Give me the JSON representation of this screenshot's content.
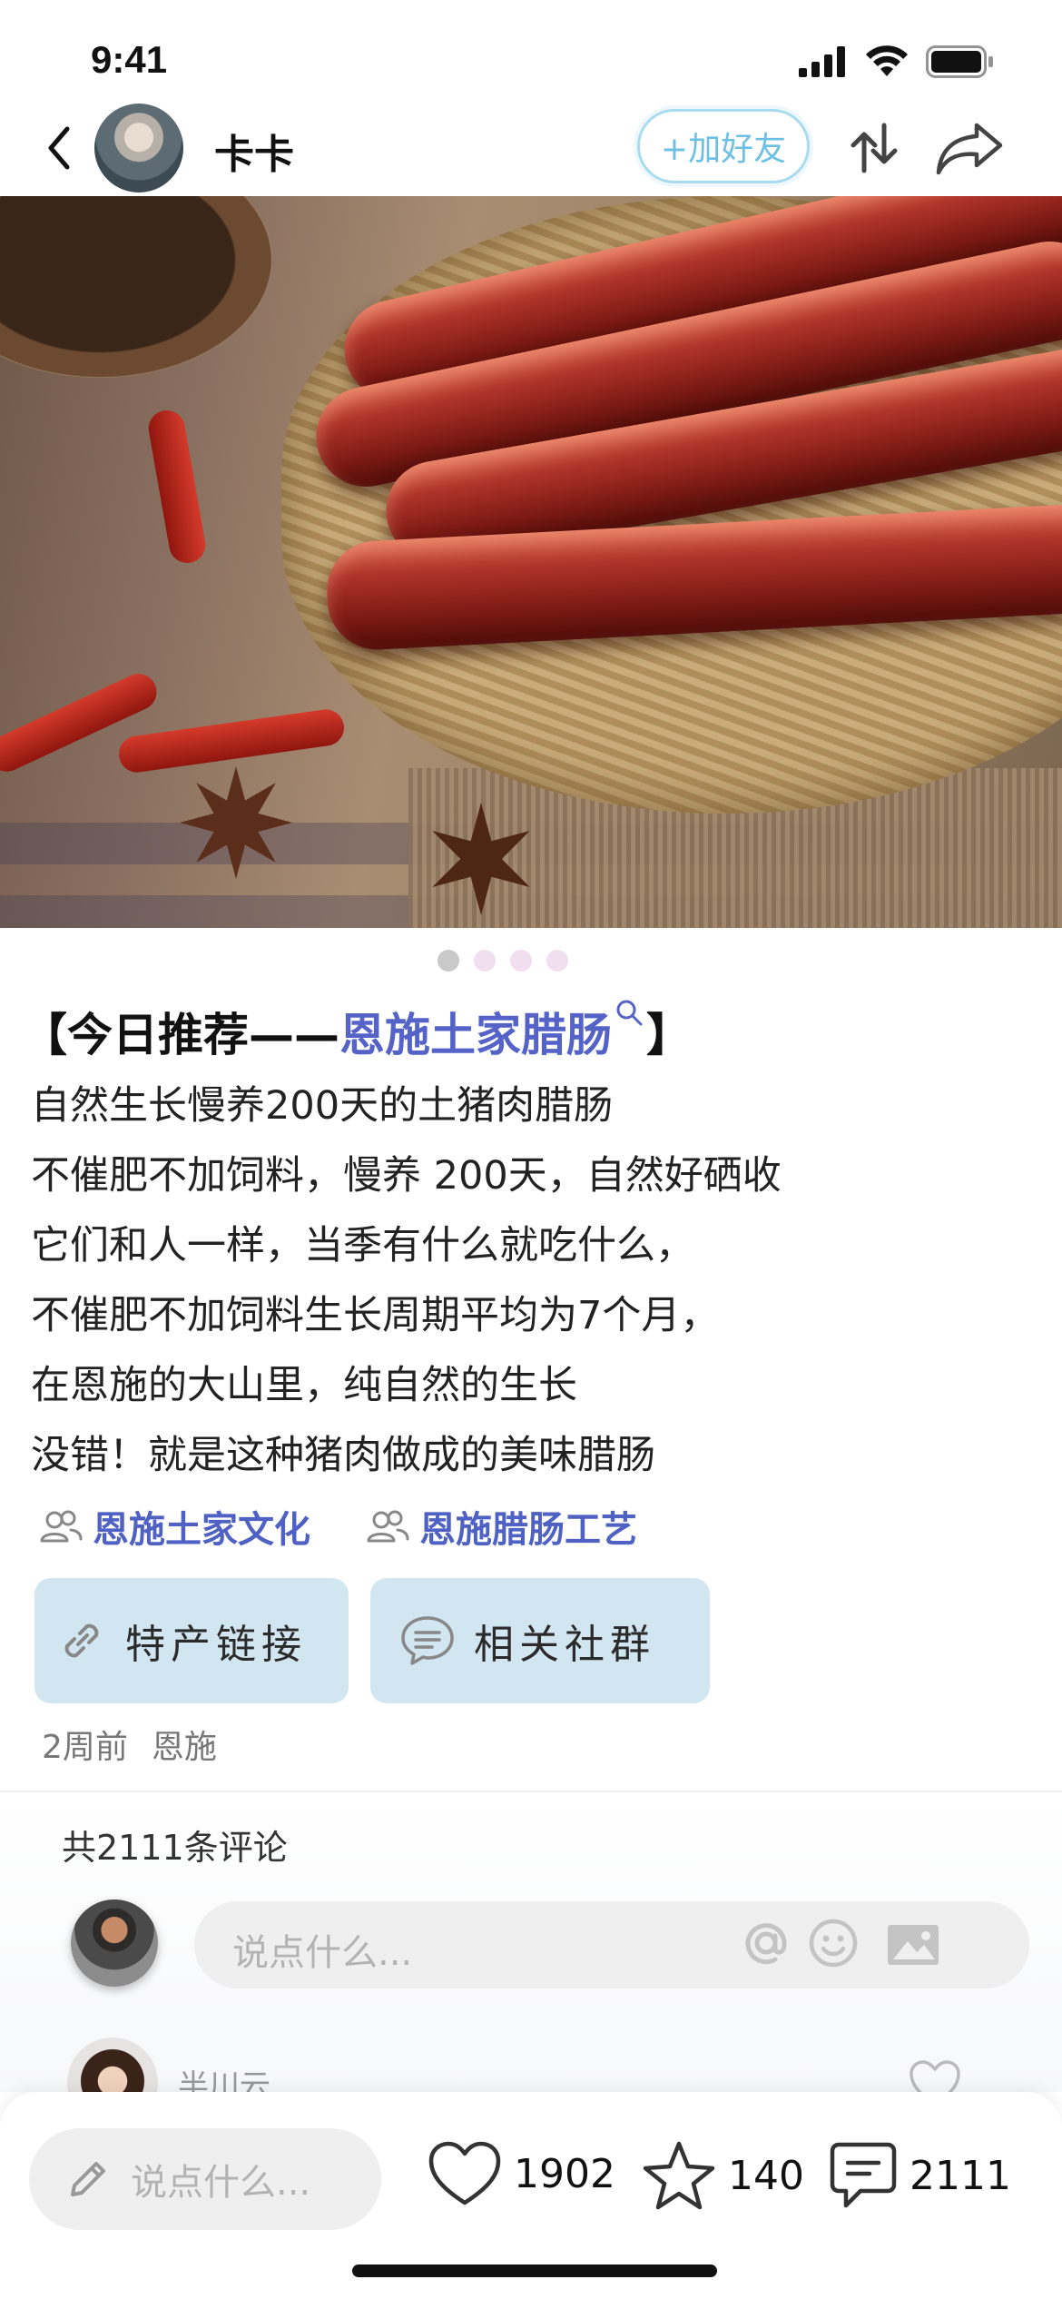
{
  "status_bar": {
    "time": "9:41"
  },
  "header": {
    "back_icon": "chevron-left-icon",
    "username": "卡卡",
    "add_friend_label": "+加好友",
    "sort_icon": "sort-arrows-icon",
    "share_icon": "share-arrow-icon"
  },
  "carousel": {
    "total": 4,
    "active_index": 0
  },
  "post": {
    "title_prefix": "【今日推荐——",
    "title_highlight": "恩施土家腊肠",
    "title_suffix": "】",
    "lines": [
      "自然生长慢养200天的土猪肉腊肠",
      "不催肥不加饲料，慢养 200天，自然好硒收",
      "它们和人一样，当季有什么就吃什么，",
      "不催肥不加饲料生长周期平均为7个月，",
      "在恩施的大山里，纯自然的生长",
      "没错！就是这种猪肉做成的美味腊肠"
    ],
    "tags": [
      "恩施土家文化",
      "恩施腊肠工艺"
    ],
    "buttons": {
      "link": "特产链接",
      "group": "相关社群"
    },
    "meta_time": "2周前",
    "meta_location": "恩施"
  },
  "comments": {
    "count_label": "共2111条评论",
    "input_placeholder": "说点什么...",
    "preview_username": "半川云"
  },
  "bottom_bar": {
    "input_placeholder": "说点什么...",
    "likes": "1902",
    "favorites": "140",
    "comments": "2111"
  },
  "colors": {
    "accent_blue": "#5563c8",
    "tag_blue": "#5061c4",
    "add_friend_border": "#a8dbef",
    "button_bg": "#d2e6f2"
  }
}
